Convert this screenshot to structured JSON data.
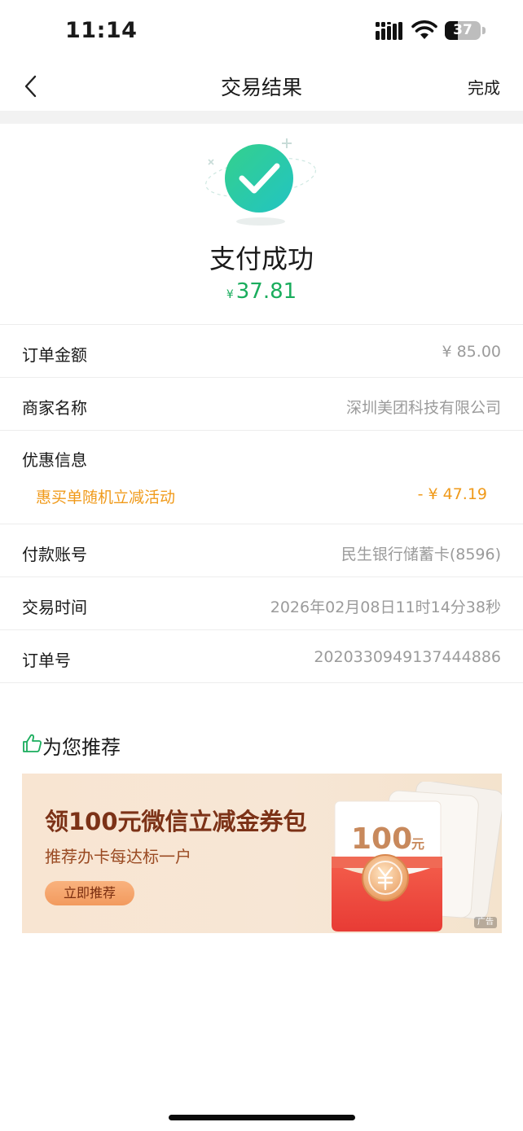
{
  "status_bar": {
    "time": "11:14",
    "battery_level": "37",
    "battery_fraction": 0.37
  },
  "nav": {
    "title": "交易结果",
    "done_label": "完成"
  },
  "result": {
    "status_text": "支付成功",
    "currency_symbol": "¥",
    "amount": "37.81"
  },
  "details": {
    "order_amount": {
      "label": "订单金额",
      "value": "¥ 85.00"
    },
    "merchant": {
      "label": "商家名称",
      "value": "深圳美团科技有限公司"
    },
    "discount": {
      "label": "优惠信息",
      "name": "惠买单随机立减活动",
      "value": "- ¥ 47.19"
    },
    "account": {
      "label": "付款账号",
      "value": "民生银行储蓄卡(8596)"
    },
    "time": {
      "label": "交易时间",
      "value": "2026年02月08日11时14分38秒"
    },
    "order_no": {
      "label": "订单号",
      "value": "2020330949137444886"
    }
  },
  "recommend": {
    "title": "为您推荐",
    "ad": {
      "title": "领100元微信立减金券包",
      "subtitle": "推荐办卡每达标一户",
      "cta_label": "立即推荐",
      "card_amount": "100",
      "card_unit": "元",
      "tag": "广告"
    }
  },
  "colors": {
    "success_green": "#1aad5d",
    "discount_orange": "#f09a1a",
    "secondary_gray": "#9b9b9b"
  },
  "icons": [
    "signal-icon",
    "wifi-icon",
    "back-chevron-icon",
    "success-check-icon",
    "thumbs-up-icon",
    "red-envelope-icon",
    "yuan-coin-icon"
  ]
}
